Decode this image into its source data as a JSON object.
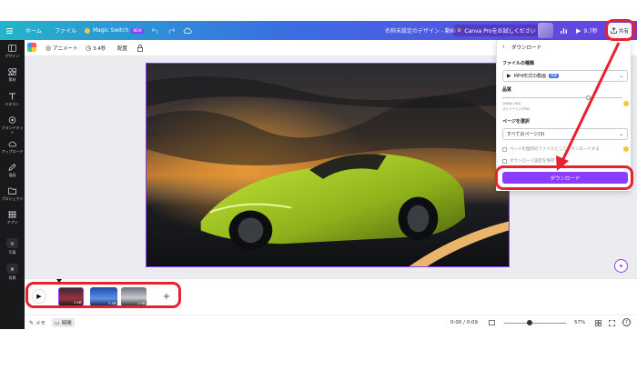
{
  "topbar": {
    "home": "ホーム",
    "file": "ファイル",
    "magic_switch": "Magic Switch",
    "new_badge": "NEW",
    "doc_title": "名称未設定のデザイン - 動画",
    "canva_pro": "Canva Proをお試しください",
    "play_label": "9.7秒",
    "share_label": "共有"
  },
  "sidebar": {
    "items": [
      "デザイン",
      "素材",
      "テキスト",
      "ブランドキット",
      "アップロード",
      "描画",
      "プロジェクト",
      "アプリ",
      "写真",
      "背景"
    ]
  },
  "toolbar": {
    "animate": "アニメート",
    "duration": "3.4秒",
    "position": "配置"
  },
  "panel": {
    "title": "ダウンロード",
    "file_type_label": "ファイルの種類",
    "file_type_value": "MP4形式の動画",
    "file_type_badge": "推奨",
    "quality_label": "品質",
    "quality_sub1": "1080p (HD)",
    "quality_sub2": "ストリーミングHD",
    "pages_label": "ページを選択",
    "pages_value": "すべてのページ(3)",
    "option1": "ページを個別のファイルとしてダウンロードする",
    "option2": "ダウンロード設定を保存",
    "download_button": "ダウンロード"
  },
  "timeline": {
    "clip1": "3.4秒",
    "clip2": "3.4秒",
    "clip3": "2.9秒"
  },
  "bottombar": {
    "notes": "メモ",
    "time_mode": "時間",
    "timecode": "0:00 / 0:09",
    "zoom": "57%"
  },
  "colors": {
    "accent": "#8b3dff",
    "highlight": "#e8212e",
    "sidebar_bg": "#18191b"
  }
}
